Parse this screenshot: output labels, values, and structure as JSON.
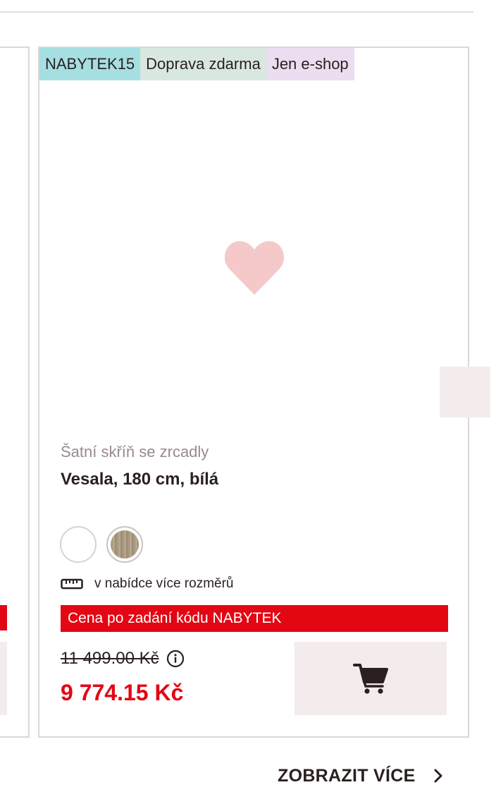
{
  "card": {
    "badges": {
      "code": "NABYTEK15",
      "shipping": "Doprava zdarma",
      "eshop": "Jen e-shop"
    },
    "wishlist_icon": "heart-icon",
    "subtitle": "Šatní skříň se zrcadly",
    "title": "Vesala, 180 cm, bílá",
    "swatches": [
      {
        "name": "white",
        "color": "#ffffff"
      },
      {
        "name": "oak",
        "color": "#a7977f"
      }
    ],
    "sizes_note": "v nabídce více rozměrů",
    "sizes_icon": "ruler-icon",
    "promo": "Cena po zadání kódu NABYTEK",
    "old_price": "11 499.00 Kč",
    "info_icon": "info-icon",
    "new_price": "9 774.15 Kč",
    "cart_icon": "cart-icon"
  },
  "show_more": {
    "label": "ZOBRAZIT VÍCE",
    "icon": "chevron-right-icon"
  },
  "colors": {
    "accent_red": "#e30613",
    "badge_code": "#a6dfe1",
    "badge_shipping": "#d8e8e1",
    "badge_eshop": "#eadef0",
    "heart": "#f5c9c9",
    "button_bg": "#f4ecec"
  }
}
